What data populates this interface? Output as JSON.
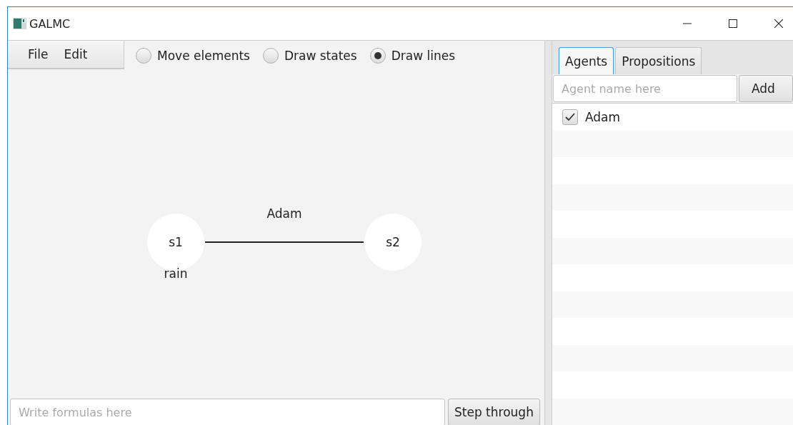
{
  "window": {
    "title": "GALMC"
  },
  "menu": [
    "File",
    "Edit"
  ],
  "modes": [
    {
      "label": "Move elements",
      "selected": false
    },
    {
      "label": "Draw states",
      "selected": false
    },
    {
      "label": "Draw lines",
      "selected": true
    }
  ],
  "graph": {
    "states": [
      {
        "name": "s1",
        "propositions": "rain"
      },
      {
        "name": "s2"
      }
    ],
    "edges": [
      {
        "label": "Adam"
      }
    ]
  },
  "formula": {
    "placeholder": "Write formulas here",
    "button": "Step through"
  },
  "tabs": [
    {
      "label": "Agents",
      "selected": true
    },
    {
      "label": "Propositions",
      "selected": false
    }
  ],
  "agent_input": {
    "placeholder": "Agent name here",
    "button": "Add"
  },
  "agents": [
    {
      "name": "Adam",
      "checked": true
    }
  ]
}
